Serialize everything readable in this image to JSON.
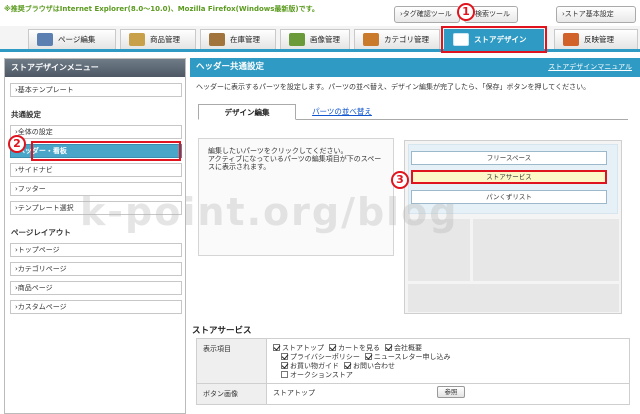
{
  "notice": "※推奨ブラウザはInternet Explorer(8.0〜10.0)、Mozilla Firefox(Windows最新版)です。",
  "header_links": {
    "tag_tool": "›タグ確認ツール",
    "search_tool": "› 検索ツール",
    "store_settings": "›ストア基本設定"
  },
  "nav": {
    "tabs": [
      {
        "label": "ページ編集",
        "icon": "page-edit-icon",
        "color": "#5a7fb0"
      },
      {
        "label": "商品管理",
        "icon": "product-icon",
        "color": "#c9a04a"
      },
      {
        "label": "在庫管理",
        "icon": "inventory-icon",
        "color": "#a0743c"
      },
      {
        "label": "画像管理",
        "icon": "image-icon",
        "color": "#6a9a3a"
      },
      {
        "label": "カテゴリ管理",
        "icon": "category-icon",
        "color": "#c97a2a"
      },
      {
        "label": "ストアデザイン",
        "icon": "store-design-icon",
        "color": "#ffffff"
      },
      {
        "label": "反映管理",
        "icon": "publish-icon",
        "color": "#d0622a"
      }
    ],
    "active_index": 5
  },
  "badges": {
    "one": "1",
    "two": "2",
    "three": "3"
  },
  "sidebar": {
    "title": "ストアデザインメニュー",
    "basic_template": "›基本テンプレート",
    "common_section": "共通設定",
    "common_items": [
      "›全体の設定",
      "›ヘッダー・看板",
      "›サイドナビ",
      "›フッター",
      "›テンプレート選択"
    ],
    "layout_section": "ページレイアウト",
    "layout_items": [
      "›トップページ",
      "›カテゴリページ",
      "›商品ページ",
      "›カスタムページ"
    ]
  },
  "main": {
    "title": "ヘッダー共通設定",
    "manual_link": "ストアデザインマニュアル",
    "description": "ヘッダーに表示するパーツを設定します。パーツの並べ替え、デザイン編集が完了したら、「保存」ボタンを押してください。",
    "tab_design": "デザイン編集",
    "tab_sort": "パーツの並べ替え",
    "editor_text_1": "編集したいパーツをクリックしてください。",
    "editor_text_2": "アクティブになっているパーツの編集項目が下のスペースに表示されます。",
    "preview": {
      "bar1": "フリースペース",
      "bar2": "ストアサービス",
      "bar3": "パンくずリスト"
    }
  },
  "service": {
    "title": "ストアサービス",
    "display_label": "表示項目",
    "line1": [
      {
        "label": "ストアトップ",
        "checked": true
      },
      {
        "label": "カートを見る",
        "checked": true
      },
      {
        "label": "会社概要",
        "checked": true
      }
    ],
    "line2": [
      {
        "label": "プライバシーポリシー",
        "checked": true
      },
      {
        "label": "ニュースレター申し込み",
        "checked": true
      }
    ],
    "line3": [
      {
        "label": "お買い物ガイド",
        "checked": true
      },
      {
        "label": "お問い合わせ",
        "checked": true
      }
    ],
    "line4": [
      {
        "label": "オークションストア",
        "checked": false
      }
    ],
    "button_image_label": "ボタン画像",
    "button_image_value": "ストアトップ",
    "browse_button": "参照"
  },
  "watermark": "k-point.org/blog"
}
